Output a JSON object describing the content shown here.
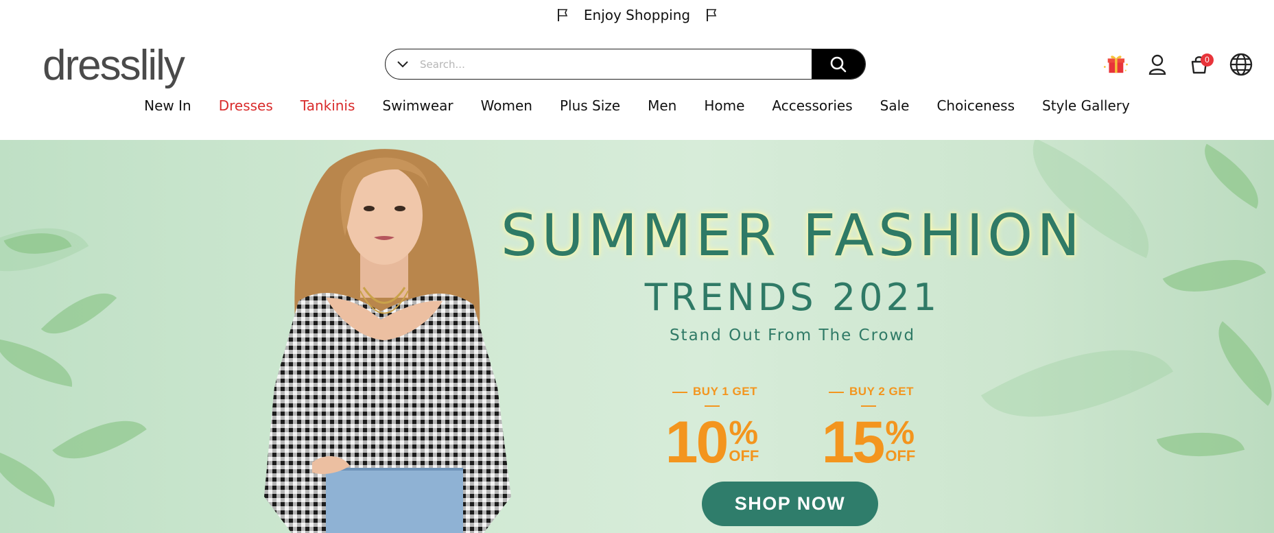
{
  "announcement": {
    "text": "Enjoy Shopping"
  },
  "header": {
    "logo": "dresslily",
    "search": {
      "placeholder": "Search..."
    },
    "cart_count": "0"
  },
  "nav": {
    "items": [
      {
        "label": "New In",
        "highlight": false
      },
      {
        "label": "Dresses",
        "highlight": true
      },
      {
        "label": "Tankinis",
        "highlight": true
      },
      {
        "label": "Swimwear",
        "highlight": false
      },
      {
        "label": "Women",
        "highlight": false
      },
      {
        "label": "Plus Size",
        "highlight": false
      },
      {
        "label": "Men",
        "highlight": false
      },
      {
        "label": "Home",
        "highlight": false
      },
      {
        "label": "Accessories",
        "highlight": false
      },
      {
        "label": "Sale",
        "highlight": false
      },
      {
        "label": "Choiceness",
        "highlight": false
      },
      {
        "label": "Style Gallery",
        "highlight": false
      }
    ]
  },
  "hero": {
    "title": "SUMMER FASHION",
    "subtitle": "TRENDS 2021",
    "tagline": "Stand Out From The Crowd",
    "offers": [
      {
        "label": "BUY 1 GET",
        "value": "10",
        "percent": "%",
        "suffix": "OFF"
      },
      {
        "label": "BUY 2 GET",
        "value": "15",
        "percent": "%",
        "suffix": "OFF"
      }
    ],
    "cta": "SHOP NOW"
  },
  "colors": {
    "highlight_nav": "#d92b2b",
    "hero_text": "#2f7a66",
    "offer": "#f3951e",
    "cta_bg": "#2f7d6b",
    "badge": "#e8343a"
  },
  "icons": [
    "flag-icon",
    "chevron-down-icon",
    "search-icon",
    "gift-icon",
    "user-icon",
    "cart-icon",
    "globe-icon"
  ]
}
